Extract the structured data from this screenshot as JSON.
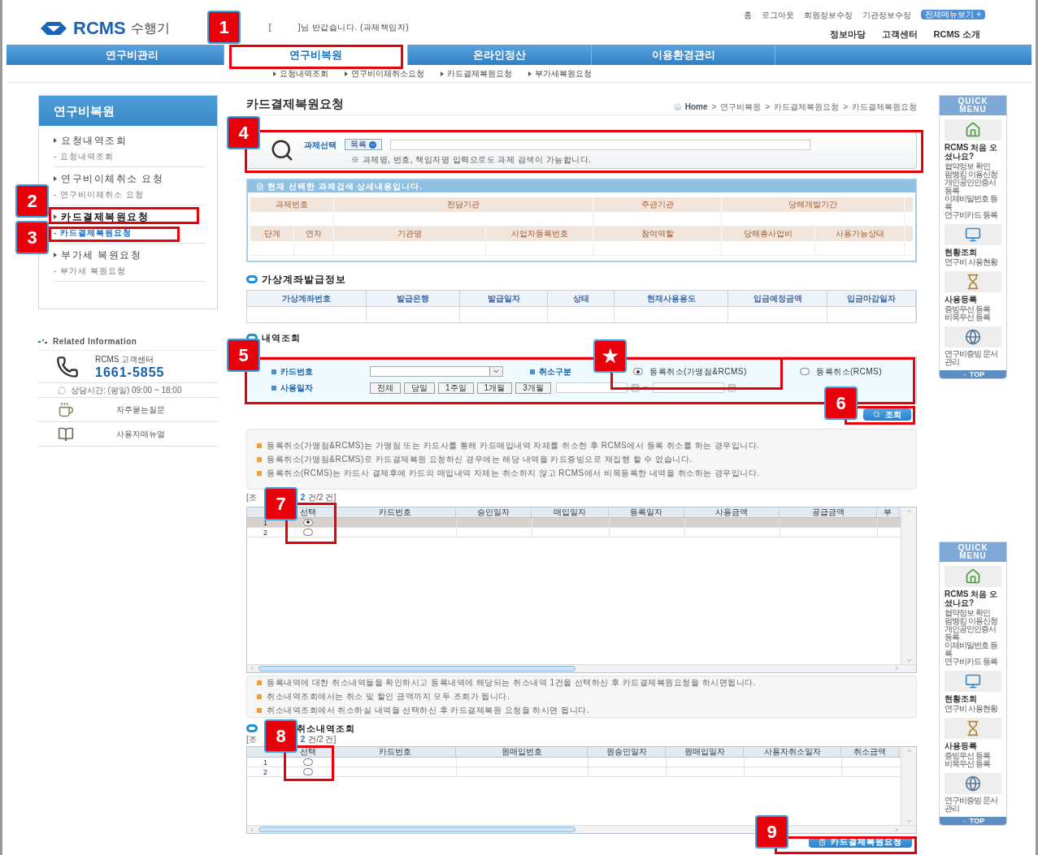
{
  "header": {
    "logo": "RCMS",
    "logo_suffix": "수행기",
    "greeting": "[          ]님 반갑습니다. (과제책임자)",
    "top_links": [
      "홈",
      "로그아웃",
      "회원정보수정",
      "기관정보수정"
    ],
    "all_menu_button": "전체메뉴보기 +",
    "secondary_links": [
      "정보마당",
      "고객센터",
      "RCMS 소개"
    ]
  },
  "nav": [
    {
      "label": "연구비관리",
      "selected": false
    },
    {
      "label": "연구비복원",
      "selected": true
    },
    {
      "label": "온라인정산",
      "selected": false
    },
    {
      "label": "이용환경관리",
      "selected": false
    }
  ],
  "subnav": [
    "요청내역조회",
    "연구비이체취소요청",
    "카드결제복원요청",
    "부가세복원요청"
  ],
  "sidebar": {
    "title": "연구비복원",
    "groups": [
      {
        "label": "요청내역조회",
        "sub": "- 요청내역조회",
        "selected": false
      },
      {
        "label": "연구비이체취소 요청",
        "sub": "- 연구비이체취소 요청",
        "selected": false
      },
      {
        "label": "카드결제복원요청",
        "sub": "- 카드결제복원요청",
        "selected": true
      },
      {
        "label": "부가세 복원요청",
        "sub": "- 부가세 복원요청",
        "selected": false
      }
    ]
  },
  "related": {
    "title": "Related Information",
    "center": "RCMS 고객센터",
    "phone": "1661-5855",
    "hours": "상담시간: (평일) 09:00 ~ 18:00",
    "links": [
      "자주묻는질문",
      "사용자매뉴얼"
    ]
  },
  "page": {
    "title": "카드결제복원요청",
    "breadcrumb": [
      "Home",
      "연구비복원",
      "카드결제복원요청",
      "카드결제복원요청"
    ],
    "separator": ">"
  },
  "project_search": {
    "label": "과제선택",
    "dropdown": "목록",
    "note": "※ 과제명, 번호, 책임자명 입력으로도 과제 검색이 가능합니다."
  },
  "project_detail": {
    "title": "현재 선택한 과제검색 상세내용입니다.",
    "row1": [
      "과제번호",
      "전담기관",
      "주관기관",
      "당해개발기간"
    ],
    "row2": [
      "단계",
      "연차",
      "기관명",
      "사업자등록번호",
      "참여역할",
      "당해총사업비",
      "사용가능상태"
    ]
  },
  "virtual_account": {
    "title": "가상계좌발급정보",
    "columns": [
      "가상계좌번호",
      "발급은행",
      "발급일자",
      "상태",
      "현재사용용도",
      "입금예정금액",
      "입금마감일자"
    ]
  },
  "history_search": {
    "title": "내역조회",
    "card_label": "카드번호",
    "cancel_label": "취소구분",
    "options": [
      {
        "label": "등록취소(가맹점&RCMS)",
        "selected": true
      },
      {
        "label": "등록취소(RCMS)",
        "selected": false
      }
    ],
    "date_label": "사용일자",
    "periods": [
      "전체",
      "당일",
      "1주일",
      "1개월",
      "3개월"
    ],
    "range_separator": "~",
    "search_button": "조회"
  },
  "notes1": [
    "등록취소(가맹점&RCMS)는 가맹점 또는 카드사를 통해 카드매입내역 자체를 취소한 후 RCMS에서 등록 취소를 하는 경우입니다.",
    "등록취소(가맹점&RCMS)로 카드결제복원 요청하신 경우에는 해당 내역을 카드증빙으로 재집행 할 수 없습니다.",
    "등록취소(RCMS)는 카드사 결제후에 카드의 매입내역 자체는 취소하지 않고 RCMS에서 비목등록한 내역을 취소하는 경우입니다."
  ],
  "results": {
    "count_prefix": "[조",
    "count": "2",
    "count_suffix": "건/2 건]",
    "columns": [
      "선택",
      "카드번호",
      "승인일자",
      "매입일자",
      "등록일자",
      "사용금액",
      "공급금액",
      "부"
    ],
    "rows": [
      {
        "no": "1",
        "selected": true
      },
      {
        "no": "2",
        "selected": false
      }
    ]
  },
  "notes2": [
    "등록내역에 대한 취소내역들을 확인하시고 등록내역에 해당되는 취소내역 1건을 선택하신 후 카드결제복원요청을 하시면됩니다.",
    "취소내역조회에서는 취소 및 할인 금액까지 모두 조회가 됩니다.",
    "취소내역조회에서 취소하실 내역을 선택하신 후 카드결제복원 요청을 하시면 됩니다."
  ],
  "cancel_results": {
    "title": "취소내역조회",
    "count_prefix": "[조",
    "count": "2",
    "count_suffix": "건/2 건]",
    "columns": [
      "선택",
      "카드번호",
      "원매입번호",
      "원승인일자",
      "원매입일자",
      "사용자취소일자",
      "취소금액"
    ],
    "rows": [
      {
        "no": "1",
        "selected": false
      },
      {
        "no": "2",
        "selected": false
      }
    ]
  },
  "submit_button": "카드결제복원요청",
  "quick_menus": [
    {
      "title": "QUICK MENU",
      "sections": [
        {
          "title": "RCMS 처음 오셨나요?",
          "links": [
            "협약정보 확인",
            "펌뱅킹 이용신청",
            "개인공인인증서 등록",
            "이체비밀번호 등록",
            "연구비카드 등록"
          ]
        },
        {
          "title": "현황조회",
          "links": [
            "연구비 사용현황"
          ]
        },
        {
          "title": "사용등록",
          "links": [
            "증빙우선 등록",
            "비목우선 등록"
          ]
        },
        {
          "links": [
            "연구비증빙 문서 관리"
          ]
        }
      ],
      "top": "TOP"
    },
    {
      "title": "QUICK MENU",
      "sections": [
        {
          "title": "RCMS 처음 오셨나요?",
          "links": [
            "협약정보 확인",
            "펌뱅킹 이용신청",
            "개인공인인증서 등록",
            "이체비밀번호 등록",
            "연구비카드 등록"
          ]
        },
        {
          "title": "현황조회",
          "links": [
            "연구비 사용현황"
          ]
        },
        {
          "title": "사용등록",
          "links": [
            "증빙우선 등록",
            "비목우선 등록"
          ]
        },
        {
          "links": [
            "연구비증빙 문서 관리"
          ]
        }
      ],
      "top": "TOP"
    }
  ],
  "callouts": [
    {
      "label": "1"
    },
    {
      "label": "2"
    },
    {
      "label": "3"
    },
    {
      "label": "4"
    },
    {
      "label": "5"
    },
    {
      "label": "★"
    },
    {
      "label": "6"
    },
    {
      "label": "7"
    },
    {
      "label": "8"
    },
    {
      "label": "9"
    }
  ]
}
